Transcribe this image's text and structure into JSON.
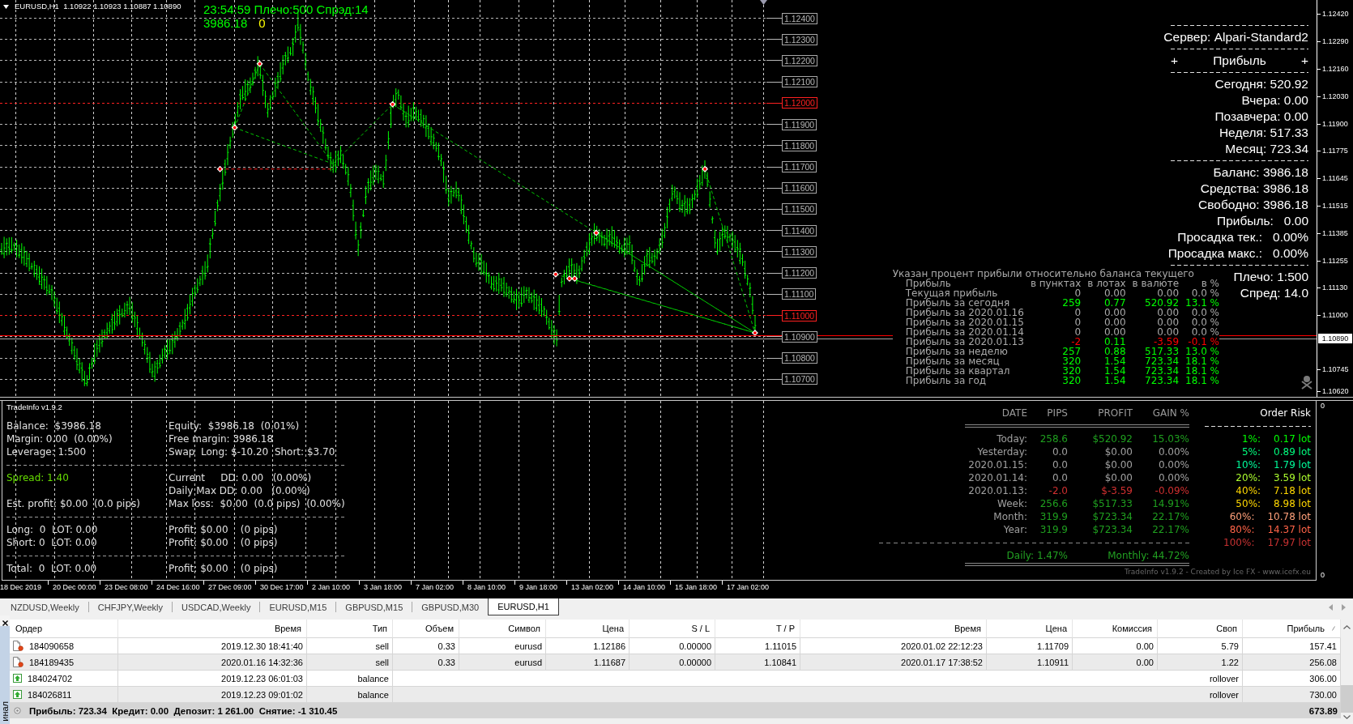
{
  "chart": {
    "symbol_line": "EURUSD,H1  1.10922 1.10923 1.10887 1.10890",
    "status_line": "23:54:59 Плечо:500 Спрэд:14",
    "equity": "3986.18",
    "open_orders": "0",
    "level_labels": [
      {
        "text": "1.12400",
        "highlighted": false
      },
      {
        "text": "1.12300",
        "highlighted": false
      },
      {
        "text": "1.12200",
        "highlighted": false
      },
      {
        "text": "1.12100",
        "highlighted": false
      },
      {
        "text": "1.12000",
        "highlighted": true
      },
      {
        "text": "1.11900",
        "highlighted": false
      },
      {
        "text": "1.11800",
        "highlighted": false
      },
      {
        "text": "1.11700",
        "highlighted": false
      },
      {
        "text": "1.11600",
        "highlighted": false
      },
      {
        "text": "1.11500",
        "highlighted": false
      },
      {
        "text": "1.11400",
        "highlighted": false
      },
      {
        "text": "1.11300",
        "highlighted": false
      },
      {
        "text": "1.11200",
        "highlighted": false
      },
      {
        "text": "1.11100",
        "highlighted": false
      },
      {
        "text": "1.11000",
        "highlighted": true
      },
      {
        "text": "1.10900",
        "highlighted": false
      },
      {
        "text": "1.10800",
        "highlighted": false
      },
      {
        "text": "1.10700",
        "highlighted": false
      }
    ],
    "price_axis": [
      "1.12420",
      "1.12290",
      "1.12160",
      "1.12030",
      "1.11900",
      "1.11775",
      "1.11645",
      "1.11515",
      "1.11385",
      "1.11255",
      "1.11130",
      "1.11000",
      "1.10745",
      "1.10620"
    ],
    "current_price": "1.10890",
    "info_panel": {
      "server": "Сервер: Alpari-Standard2",
      "section_title": {
        "left": "+",
        "title": "Прибыль",
        "right": "+"
      },
      "profit_lines": [
        "Сегодня: 520.92",
        "Вчера: 0.00",
        "Позавчера: 0.00",
        "Неделя: 517.33",
        "Месяц: 723.34"
      ],
      "account_lines": [
        "Баланс: 3986.18",
        "Средства: 3986.18",
        "Свободно: 3986.18",
        "Прибыль:   0.00",
        "Просадка тек.:   0.00%",
        "Просадка макс.:   0.00%"
      ],
      "leverage": "Плечо: 1:500",
      "spread": "Спред: 14.0"
    },
    "profit_table": {
      "note": "Указан процент прибыли относительно баланса текущего",
      "label_column": "Прибыль",
      "columns": [
        "в пунктах",
        "в лотах",
        "в валюте",
        "в %"
      ],
      "rows": [
        {
          "label": "Текущая прибыль",
          "cells": [
            {
              "text": "0",
              "color": "#a9a9a9"
            },
            {
              "text": "0.00",
              "color": "#a9a9a9"
            },
            {
              "text": "0.00",
              "color": "#a9a9a9"
            },
            {
              "text": "0.0 %",
              "color": "#a9a9a9"
            }
          ]
        },
        {
          "label": "Прибыль за сегодня",
          "cells": [
            {
              "text": "259",
              "color": "#00ff00"
            },
            {
              "text": "0.77",
              "color": "#00ff00"
            },
            {
              "text": "520.92",
              "color": "#00ff00"
            },
            {
              "text": "13.1 %",
              "color": "#00ff00"
            }
          ]
        },
        {
          "label": "Прибыль за 2020.01.16",
          "cells": [
            {
              "text": "0",
              "color": "#a9a9a9"
            },
            {
              "text": "0.00",
              "color": "#a9a9a9"
            },
            {
              "text": "0.00",
              "color": "#a9a9a9"
            },
            {
              "text": "0.0 %",
              "color": "#a9a9a9"
            }
          ]
        },
        {
          "label": "Прибыль за 2020.01.15",
          "cells": [
            {
              "text": "0",
              "color": "#a9a9a9"
            },
            {
              "text": "0.00",
              "color": "#a9a9a9"
            },
            {
              "text": "0.00",
              "color": "#a9a9a9"
            },
            {
              "text": "0.0 %",
              "color": "#a9a9a9"
            }
          ]
        },
        {
          "label": "Прибыль за 2020.01.14",
          "cells": [
            {
              "text": "0",
              "color": "#a9a9a9"
            },
            {
              "text": "0.00",
              "color": "#a9a9a9"
            },
            {
              "text": "0.00",
              "color": "#a9a9a9"
            },
            {
              "text": "0.0 %",
              "color": "#a9a9a9"
            }
          ]
        },
        {
          "label": "Прибыль за 2020.01.13",
          "cells": [
            {
              "text": "-2",
              "color": "#ff0000"
            },
            {
              "text": "0.11",
              "color": "#00ff00"
            },
            {
              "text": "-3.59",
              "color": "#ff0000"
            },
            {
              "text": "-0.1 %",
              "color": "#ff0000"
            }
          ]
        },
        {
          "label": "Прибыль за неделю",
          "cells": [
            {
              "text": "257",
              "color": "#00ff00"
            },
            {
              "text": "0.88",
              "color": "#00ff00"
            },
            {
              "text": "517.33",
              "color": "#00ff00"
            },
            {
              "text": "13.0 %",
              "color": "#00ff00"
            }
          ]
        },
        {
          "label": "Прибыль за месяц",
          "cells": [
            {
              "text": "320",
              "color": "#00ff00"
            },
            {
              "text": "1.54",
              "color": "#00ff00"
            },
            {
              "text": "723.34",
              "color": "#00ff00"
            },
            {
              "text": "18.1 %",
              "color": "#00ff00"
            }
          ]
        },
        {
          "label": "Прибыль за квартал",
          "cells": [
            {
              "text": "320",
              "color": "#00ff00"
            },
            {
              "text": "1.54",
              "color": "#00ff00"
            },
            {
              "text": "723.34",
              "color": "#00ff00"
            },
            {
              "text": "18.1 %",
              "color": "#00ff00"
            }
          ]
        },
        {
          "label": "Прибыль за год",
          "cells": [
            {
              "text": "320",
              "color": "#00ff00"
            },
            {
              "text": "1.54",
              "color": "#00ff00"
            },
            {
              "text": "723.34",
              "color": "#00ff00"
            },
            {
              "text": "18.1 %",
              "color": "#00ff00"
            }
          ]
        }
      ]
    }
  },
  "trade_info": {
    "title": "TradeInfo v1.9.2",
    "sections": [
      [
        {
          "left": {
            "text": "Balance:  $3986.18",
            "color": "#e0e0e0"
          },
          "right": "Equity:  $3986.18  (0.01%)"
        },
        {
          "left": {
            "text": "Margin: 0.00  (0.00%)",
            "color": "#e0e0e0"
          },
          "right": "Free margin: 3986.18"
        },
        {
          "left": {
            "text": "Leverage: 1:500",
            "color": "#e0e0e0"
          },
          "right": "Swap  Long: $-10.20  Short: $3.70"
        }
      ],
      [
        {
          "left": {
            "text": "Spread: 1.40",
            "color": "#66dd00"
          },
          "right": "Current     DD: 0.00   (0.00%)"
        },
        {
          "right": "Daily Max DD: 0.00   (0.00%)"
        },
        {
          "left": {
            "text": "Est. profit: $0.00  (0.0 pips)",
            "color": "#e0e0e0"
          },
          "right": "Max loss:  $0.00  (0.0 pips)  (0.00%)"
        }
      ],
      [
        {
          "left": {
            "text": "Long:  0  LOT: 0.00",
            "color": "#e0e0e0"
          },
          "right": "Profit: $0.00    (0 pips)"
        },
        {
          "left": {
            "text": "Short: 0  LOT: 0.00",
            "color": "#e0e0e0"
          },
          "right": "Profit: $0.00    (0 pips)"
        }
      ],
      [
        {
          "left": {
            "text": "Total:  0  LOT: 0.00",
            "color": "#e0e0e0"
          },
          "right": "Profit: $0.00    (0 pips)"
        }
      ]
    ],
    "stats": {
      "columns": [
        "DATE",
        "PIPS",
        "PROFIT",
        "GAIN %"
      ],
      "rows": [
        {
          "label": "Today:",
          "pips": "258.6",
          "profit": "$520.92",
          "gain": "15.03%",
          "color": "#1f9f1f"
        },
        {
          "label": "Yesterday:",
          "pips": "0.0",
          "profit": "$0.00",
          "gain": "0.00%",
          "color": "#a0a0a0"
        },
        {
          "label": "2020.01.15:",
          "pips": "0.0",
          "profit": "$0.00",
          "gain": "0.00%",
          "color": "#a0a0a0"
        },
        {
          "label": "2020.01.14:",
          "pips": "0.0",
          "profit": "$0.00",
          "gain": "0.00%",
          "color": "#a0a0a0"
        },
        {
          "label": "2020.01.13:",
          "pips": "-2.0",
          "profit": "$-3.59",
          "gain": "-0.09%",
          "color": "#d03030"
        },
        {
          "label": "Week:",
          "pips": "256.6",
          "profit": "$517.33",
          "gain": "14.91%",
          "color": "#1f9f1f"
        },
        {
          "label": "Month:",
          "pips": "319.9",
          "profit": "$723.34",
          "gain": "22.17%",
          "color": "#1f9f1f"
        },
        {
          "label": "Year:",
          "pips": "319.9",
          "profit": "$723.34",
          "gain": "22.17%",
          "color": "#1f9f1f"
        }
      ],
      "daily": "Daily: 1.47%",
      "monthly": "Monthly: 44.72%"
    },
    "order_risk": {
      "title": "Order Risk",
      "rows": [
        {
          "risk": "1%:",
          "lots": "0.17 lot",
          "color": "#00ff00"
        },
        {
          "risk": "5%:",
          "lots": "0.89 lot",
          "color": "#00ff7f"
        },
        {
          "risk": "10%:",
          "lots": "1.79 lot",
          "color": "#00fa9a"
        },
        {
          "risk": "20%:",
          "lots": "3.59 lot",
          "color": "#adff2f"
        },
        {
          "risk": "40%:",
          "lots": "7.18 lot",
          "color": "#ffd700"
        },
        {
          "risk": "50%:",
          "lots": "8.98 lot",
          "color": "#ffd700"
        },
        {
          "risk": "60%:",
          "lots": "10.78 lot",
          "color": "#ffa07a"
        },
        {
          "risk": "80%:",
          "lots": "14.37 lot",
          "color": "#ff6347"
        },
        {
          "risk": "100%:",
          "lots": "17.97 lot",
          "color": "#c83232"
        }
      ]
    },
    "credit": "TradeInfo v1.9.2 - Created by Ice FX - www.icefx.eu",
    "axis_labels": [
      "0",
      "0"
    ]
  },
  "time_axis": [
    "18 Dec 2019",
    "20 Dec 00:00",
    "23 Dec 08:00",
    "24 Dec 16:00",
    "27 Dec 09:00",
    "30 Dec 17:00",
    "2 Jan 10:00",
    "3 Jan 18:00",
    "7 Jan 02:00",
    "8 Jan 10:00",
    "9 Jan 18:00",
    "13 Jan 02:00",
    "14 Jan 10:00",
    "15 Jan 18:00",
    "17 Jan 02:00"
  ],
  "tabs": [
    {
      "label": "NZDUSD,Weekly",
      "selected": false
    },
    {
      "label": "CHFJPY,Weekly",
      "selected": false
    },
    {
      "label": "USDCAD,Weekly",
      "selected": false
    },
    {
      "label": "EURUSD,M15",
      "selected": false
    },
    {
      "label": "GBPUSD,M15",
      "selected": false
    },
    {
      "label": "GBPUSD,M30",
      "selected": false
    },
    {
      "label": "EURUSD,H1",
      "selected": true
    }
  ],
  "terminal": {
    "panel_title": "инал",
    "columns": [
      {
        "label": "Ордер",
        "sorted": false
      },
      {
        "label": "Время",
        "sorted": false
      },
      {
        "label": "Тип",
        "sorted": false
      },
      {
        "label": "Объем",
        "sorted": false
      },
      {
        "label": "Символ",
        "sorted": false
      },
      {
        "label": "Цена",
        "sorted": false
      },
      {
        "label": "S / L",
        "sorted": false
      },
      {
        "label": "T / P",
        "sorted": false
      },
      {
        "label": "Время",
        "sorted": false
      },
      {
        "label": "Цена",
        "sorted": false
      },
      {
        "label": "Комиссия",
        "sorted": false
      },
      {
        "label": "Своп",
        "sorted": false
      },
      {
        "label": "Прибыль",
        "sorted": true
      }
    ],
    "rows": [
      {
        "kind": "trade",
        "order": "184090658",
        "open_time": "2019.12.30 18:41:40",
        "type": "sell",
        "volume": "0.33",
        "symbol": "eurusd",
        "open_price": "1.12186",
        "sl": "0.00000",
        "tp": "1.11015",
        "close_time": "2020.01.02 22:12:23",
        "close_price": "1.11709",
        "commission": "0.00",
        "swap": "5.79",
        "profit": "157.41"
      },
      {
        "kind": "trade",
        "order": "184189435",
        "open_time": "2020.01.16 14:32:36",
        "type": "sell",
        "volume": "0.33",
        "symbol": "eurusd",
        "open_price": "1.11687",
        "sl": "0.00000",
        "tp": "1.10841",
        "close_time": "2020.01.17 17:38:52",
        "close_price": "1.10911",
        "commission": "0.00",
        "swap": "1.22",
        "profit": "256.08"
      },
      {
        "kind": "balance",
        "order": "184024702",
        "open_time": "2019.12.23 06:01:03",
        "type": "balance",
        "comment": "rollover",
        "profit": "306.00"
      },
      {
        "kind": "balance",
        "order": "184026811",
        "open_time": "2019.12.23 09:01:02",
        "type": "balance",
        "comment": "rollover",
        "profit": "730.00"
      }
    ],
    "summary": {
      "text": "Прибыль: 723.34  Кредит: 0.00  Депозит: 1 261.00  Снятие: -1 310.45",
      "total": "673.89"
    }
  }
}
